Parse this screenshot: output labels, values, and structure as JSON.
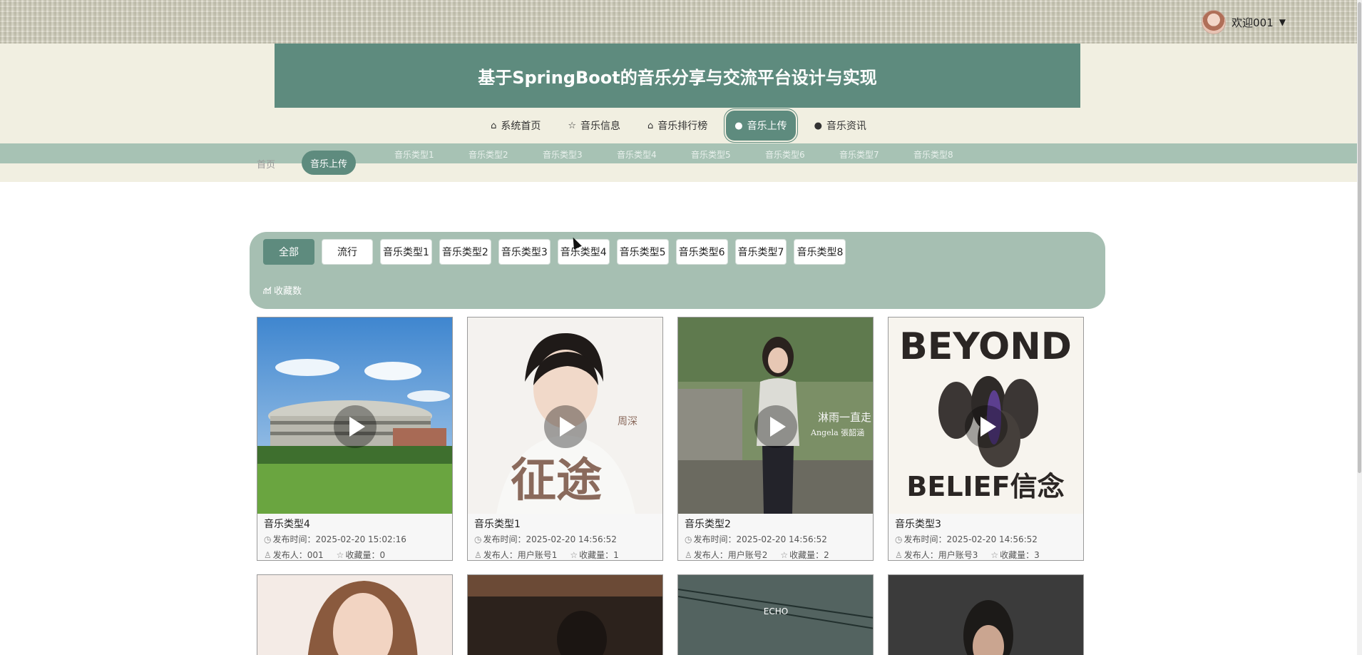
{
  "user": {
    "welcome": "欢迎001",
    "caret": "▼"
  },
  "site_title": "基于SpringBoot的音乐分享与交流平台设计与实现",
  "nav": [
    {
      "icon": "⌂",
      "label": "系统首页"
    },
    {
      "icon": "☆",
      "label": "音乐信息"
    },
    {
      "icon": "⌂",
      "label": "音乐排行榜"
    },
    {
      "icon": "●",
      "label": "音乐上传",
      "active": true
    },
    {
      "icon": "●",
      "label": "音乐资讯"
    }
  ],
  "sub_types": [
    "音乐类型1",
    "音乐类型2",
    "音乐类型3",
    "音乐类型4",
    "音乐类型5",
    "音乐类型6",
    "音乐类型7",
    "音乐类型8"
  ],
  "breadcrumb": {
    "home": "首页",
    "current": "音乐上传"
  },
  "filters": [
    "全部",
    "流行",
    "音乐类型1",
    "音乐类型2",
    "音乐类型3",
    "音乐类型4",
    "音乐类型5",
    "音乐类型6",
    "音乐类型7",
    "音乐类型8"
  ],
  "sort_label": "收藏数",
  "cards": [
    {
      "name": "音乐类型4",
      "time": "发布时间：2025-02-20 15:02:16",
      "publisher": "发布人：001",
      "favorites": "收藏量：0",
      "colors": [
        "#4f8fd1",
        "#8ab8e3",
        "#4d8a36",
        "#6fae45"
      ]
    },
    {
      "name": "音乐类型1",
      "time": "发布时间：2025-02-20 14:56:52",
      "publisher": "发布人：用户账号1",
      "favorites": "收藏量：1",
      "colors": [
        "#f4f2ef",
        "#ece8e2",
        "#2a2522",
        "#9a7b6b"
      ]
    },
    {
      "name": "音乐类型2",
      "time": "发布时间：2025-02-20 14:56:52",
      "publisher": "发布人：用户账号2",
      "favorites": "收藏量：2",
      "colors": [
        "#6f8a5c",
        "#9aa28c",
        "#3a3a34",
        "#8f8a80"
      ]
    },
    {
      "name": "音乐类型3",
      "time": "发布时间：2025-02-20 14:56:52",
      "publisher": "发布人：用户账号3",
      "favorites": "收藏量：3",
      "colors": [
        "#f7f4ee",
        "#ece6da",
        "#2b2624",
        "#5c3f8f"
      ]
    }
  ],
  "cover_text": {
    "card2_artist": "周深",
    "card2_title": "征途",
    "card3_title": "淋雨一直走",
    "card3_artist": "Angela 張韶涵",
    "card4_top": "BEYOND",
    "card4_bottom": "BELIEF信念"
  },
  "row2_cover_text": "ECHO"
}
